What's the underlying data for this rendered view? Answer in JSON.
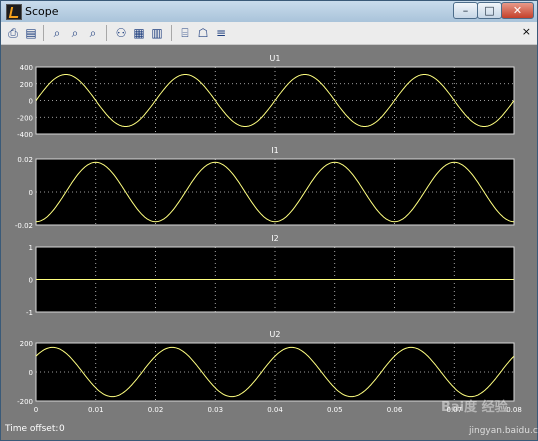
{
  "window": {
    "title": "Scope",
    "minimize": "–",
    "maximize": "□",
    "close": "✕"
  },
  "toolbar": {
    "items": [
      {
        "id": "print",
        "icon": "print-icon",
        "glyph": "⎙"
      },
      {
        "id": "params",
        "icon": "parameters-icon",
        "glyph": "▤"
      },
      {
        "id": "zoom",
        "icon": "zoom-icon",
        "glyph": "⌕"
      },
      {
        "id": "zoom-x",
        "icon": "zoom-x-icon",
        "glyph": "⌕"
      },
      {
        "id": "zoom-y",
        "icon": "zoom-y-icon",
        "glyph": "⌕"
      },
      {
        "id": "autoscale",
        "icon": "binoculars-icon",
        "glyph": "⚇"
      },
      {
        "id": "save-axes",
        "icon": "save-axes-icon",
        "glyph": "▦"
      },
      {
        "id": "restore-axes",
        "icon": "restore-axes-icon",
        "glyph": "▥"
      },
      {
        "id": "float",
        "icon": "floating-scope-icon",
        "glyph": "⌸"
      },
      {
        "id": "lock",
        "icon": "lock-icon",
        "glyph": "☖"
      },
      {
        "id": "signal-selection",
        "icon": "signal-selection-icon",
        "glyph": "≡"
      }
    ],
    "pin": "×"
  },
  "status": {
    "time_offset_label": "Time offset:",
    "time_offset_value": "0"
  },
  "watermark": {
    "text": "Bai度 经验",
    "url": "jingyan.baidu.com"
  },
  "chart_data": [
    {
      "type": "line",
      "title": "U1",
      "yticks": [
        "400",
        "200",
        "0",
        "-200",
        "-400"
      ],
      "ylim": [
        -400,
        400
      ],
      "amplitude": 311,
      "frequency_hz": 50,
      "phase_deg": 0,
      "grid": true
    },
    {
      "type": "line",
      "title": "I1",
      "yticks": [
        "0.02",
        "0",
        "-0.02"
      ],
      "ylim": [
        -0.02,
        0.02
      ],
      "amplitude": 0.018,
      "frequency_hz": 50,
      "phase_deg": -90,
      "grid": true
    },
    {
      "type": "line",
      "title": "I2",
      "yticks": [
        "1",
        "0",
        "-1"
      ],
      "ylim": [
        -1,
        1
      ],
      "amplitude": 0,
      "frequency_hz": 50,
      "phase_deg": 0,
      "grid": true
    },
    {
      "type": "line",
      "title": "U2",
      "yticks": [
        "200",
        "0",
        "-200"
      ],
      "ylim": [
        -200,
        200
      ],
      "amplitude": 170,
      "frequency_hz": 50,
      "phase_deg": 40,
      "grid": true
    }
  ],
  "x_axis": {
    "xlim": [
      0,
      0.08
    ],
    "ticks": [
      "0",
      "0.01",
      "0.02",
      "0.03",
      "0.04",
      "0.05",
      "0.06",
      "0.07",
      "0.08"
    ]
  }
}
